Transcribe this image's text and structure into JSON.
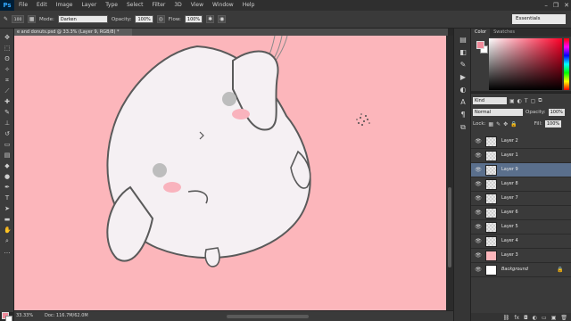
{
  "app": {
    "logo": "Ps"
  },
  "menu": [
    "File",
    "Edit",
    "Image",
    "Layer",
    "Type",
    "Select",
    "Filter",
    "3D",
    "View",
    "Window",
    "Help"
  ],
  "window_controls": {
    "minimize": "–",
    "restore": "❐",
    "close": "✕"
  },
  "options": {
    "brush_size": "100",
    "mode_label": "Mode:",
    "mode_value": "Darken",
    "opacity_label": "Opacity:",
    "opacity_value": "100%",
    "flow_label": "Flow:",
    "flow_value": "100%",
    "workspace": "Essentials"
  },
  "document": {
    "tab_title": "e and donuts.psd @ 33.3% (Layer 9, RGB/8) *"
  },
  "status": {
    "zoom": "33.33%",
    "doc_size": "Doc: 116.7M/62.0M"
  },
  "colors": {
    "foreground": "#f08a9a",
    "background": "#ffffff",
    "canvas": "#fcb6bb",
    "selected_layer": "#5a6f8c"
  },
  "color_panel": {
    "tabs": [
      "Color",
      "Swatches"
    ]
  },
  "layers_panel": {
    "kind_label": "Kind",
    "blend_mode": "Normal",
    "opacity_label": "Opacity:",
    "opacity_value": "100%",
    "lock_label": "Lock:",
    "fill_label": "Fill:",
    "fill_value": "100%",
    "layers": [
      {
        "name": "Layer 2",
        "thumb": "checker",
        "selected": false
      },
      {
        "name": "Layer 1",
        "thumb": "checker",
        "selected": false
      },
      {
        "name": "Layer 9",
        "thumb": "checker",
        "selected": true
      },
      {
        "name": "Layer 8",
        "thumb": "checker",
        "selected": false
      },
      {
        "name": "Layer 7",
        "thumb": "checker",
        "selected": false
      },
      {
        "name": "Layer 6",
        "thumb": "checker",
        "selected": false
      },
      {
        "name": "Layer 5",
        "thumb": "checker",
        "selected": false
      },
      {
        "name": "Layer 4",
        "thumb": "checker",
        "selected": false
      },
      {
        "name": "Layer 3",
        "thumb": "pink",
        "selected": false
      },
      {
        "name": "Background",
        "thumb": "white",
        "selected": false,
        "locked": true
      }
    ]
  }
}
